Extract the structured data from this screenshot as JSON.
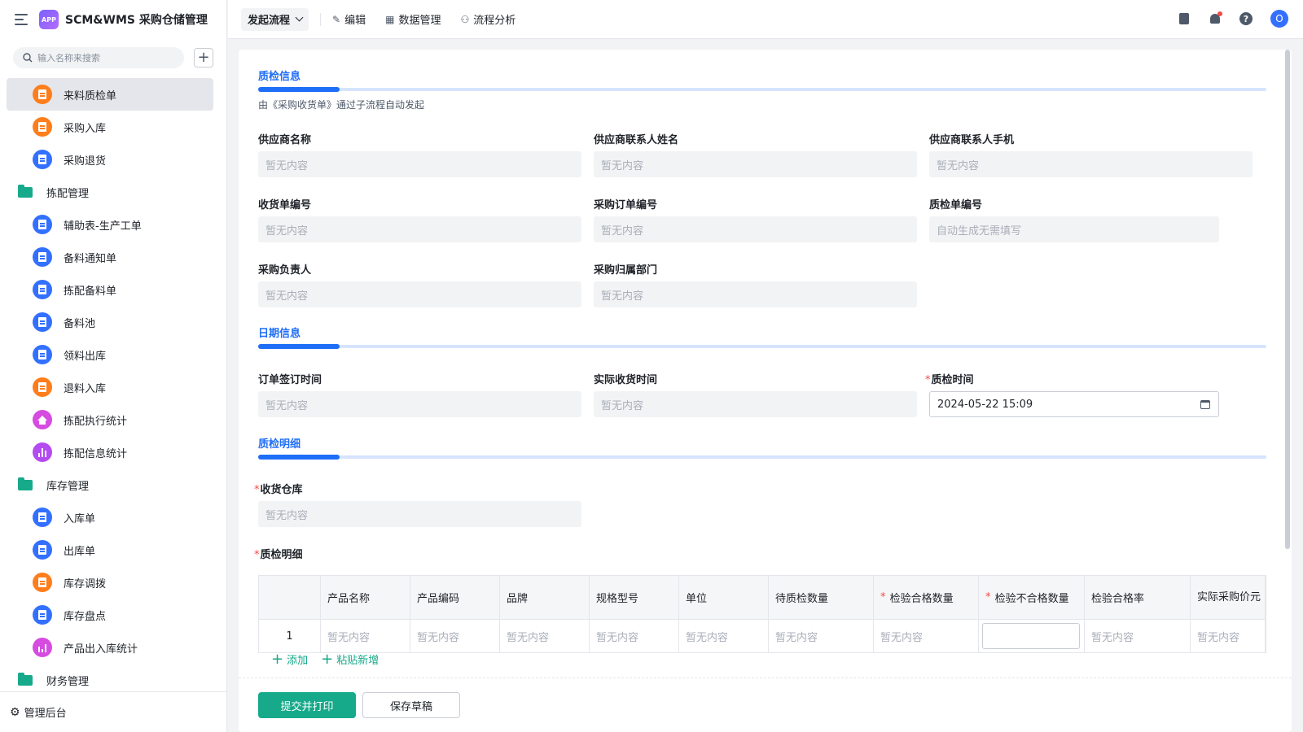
{
  "app": {
    "title": "SCM&WMS 采购仓储管理",
    "logo_text": "APP"
  },
  "search": {
    "placeholder": "输入名称来搜索"
  },
  "sidebar": {
    "items": [
      {
        "label": "来料质检单",
        "icon": "form-icon",
        "color": "#ff7d1a",
        "active": true
      },
      {
        "label": "采购入库",
        "icon": "form-icon",
        "color": "#ff7d1a"
      },
      {
        "label": "采购退货",
        "icon": "doc-icon",
        "color": "#3370ff"
      },
      {
        "label": "拣配管理",
        "icon": "folder-icon",
        "group": true
      },
      {
        "label": "辅助表-生产工单",
        "icon": "doc-icon",
        "color": "#3370ff"
      },
      {
        "label": "备料通知单",
        "icon": "doc-icon",
        "color": "#3370ff"
      },
      {
        "label": "拣配备料单",
        "icon": "doc-icon",
        "color": "#3370ff"
      },
      {
        "label": "备料池",
        "icon": "doc-icon",
        "color": "#3370ff"
      },
      {
        "label": "领料出库",
        "icon": "doc-icon",
        "color": "#3370ff"
      },
      {
        "label": "退料入库",
        "icon": "form-icon",
        "color": "#ff7d1a"
      },
      {
        "label": "拣配执行统计",
        "icon": "home-icon",
        "color": "#d64be0"
      },
      {
        "label": "拣配信息统计",
        "icon": "bar-chart-icon",
        "color": "#b44bf0"
      },
      {
        "label": "库存管理",
        "icon": "folder-icon",
        "group": true
      },
      {
        "label": "入库单",
        "icon": "doc-icon",
        "color": "#3370ff"
      },
      {
        "label": "出库单",
        "icon": "doc-icon",
        "color": "#3370ff"
      },
      {
        "label": "库存调拨",
        "icon": "form-icon",
        "color": "#ff7d1a"
      },
      {
        "label": "库存盘点",
        "icon": "doc-icon",
        "color": "#3370ff"
      },
      {
        "label": "产品出入库统计",
        "icon": "chart-icon",
        "color": "#d64be0"
      },
      {
        "label": "财务管理",
        "icon": "folder-icon",
        "group": true
      }
    ],
    "footer": "管理后台"
  },
  "topbar": {
    "launch": "发起流程",
    "edit": "编辑",
    "data_mgmt": "数据管理",
    "flow_analysis": "流程分析",
    "avatar": "O"
  },
  "sections": {
    "qc_info": {
      "title": "质检信息",
      "desc": "由《采购收货单》通过子流程自动发起"
    },
    "date_info": {
      "title": "日期信息"
    },
    "qc_detail": {
      "title": "质检明细"
    }
  },
  "fields": {
    "supplier_name": {
      "label": "供应商名称",
      "value": "暂无内容"
    },
    "supplier_contact": {
      "label": "供应商联系人姓名",
      "value": "暂无内容"
    },
    "supplier_phone": {
      "label": "供应商联系人手机",
      "value": "暂无内容"
    },
    "receipt_no": {
      "label": "收货单编号",
      "value": "暂无内容"
    },
    "po_no": {
      "label": "采购订单编号",
      "value": "暂无内容"
    },
    "qc_no": {
      "label": "质检单编号",
      "value": "自动生成无需填写"
    },
    "purchaser": {
      "label": "采购负责人",
      "value": "暂无内容"
    },
    "purchase_dept": {
      "label": "采购归属部门",
      "value": "暂无内容"
    },
    "order_date": {
      "label": "订单签订时间",
      "value": "暂无内容"
    },
    "receive_date": {
      "label": "实际收货时间",
      "value": "暂无内容"
    },
    "qc_time": {
      "label": "质检时间",
      "value": "2024-05-22 15:09"
    },
    "warehouse": {
      "label": "收货仓库",
      "value": "暂无内容"
    },
    "qc_detail_table": {
      "label": "质检明细"
    }
  },
  "table": {
    "headers": [
      "",
      "产品名称",
      "产品编码",
      "品牌",
      "规格型号",
      "单位",
      "待质检数量",
      "检验合格数量",
      "检验不合格数量",
      "检验合格率",
      "实际采购价元"
    ],
    "rows": [
      {
        "index": "1",
        "cells": [
          "暂无内容",
          "暂无内容",
          "暂无内容",
          "暂无内容",
          "暂无内容",
          "暂无内容",
          "暂无内容",
          "",
          "暂无内容",
          "暂无内容"
        ]
      }
    ]
  },
  "actions": {
    "add": "添加",
    "paste_add": "粘贴新增",
    "submit_print": "提交并打印",
    "save_draft": "保存草稿"
  }
}
